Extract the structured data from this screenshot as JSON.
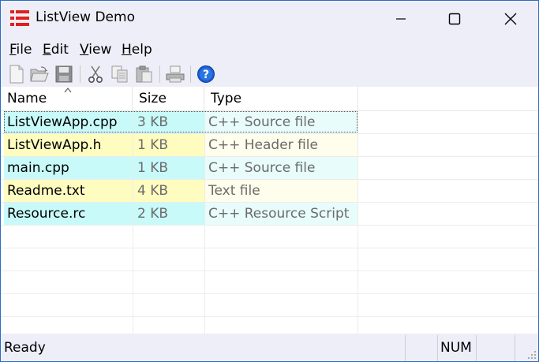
{
  "window": {
    "title": "ListView Demo",
    "accent": "#2a6ebf",
    "icon": "list-app-icon"
  },
  "menu": {
    "items": [
      {
        "label": "File",
        "u": "F",
        "rest": "ile"
      },
      {
        "label": "Edit",
        "u": "E",
        "rest": "dit"
      },
      {
        "label": "View",
        "u": "V",
        "rest": "iew"
      },
      {
        "label": "Help",
        "u": "H",
        "rest": "elp"
      }
    ]
  },
  "toolbar": {
    "buttons": [
      "new-icon",
      "open-icon",
      "save-icon",
      "cut-icon",
      "copy-icon",
      "paste-icon",
      "print-icon",
      "help-icon"
    ]
  },
  "list": {
    "columns": [
      "Name",
      "Size",
      "Type"
    ],
    "sort_column": "Name",
    "rows": [
      {
        "name": "ListViewApp.cpp",
        "size": "3 KB",
        "type": "C++ Source file",
        "color": "#c8fafa",
        "type_color": "#e8fcfc"
      },
      {
        "name": "ListViewApp.h",
        "size": "1 KB",
        "type": "C++ Header file",
        "color": "#fffcc0",
        "type_color": "#fffdeb"
      },
      {
        "name": "main.cpp",
        "size": "1 KB",
        "type": "C++ Source file",
        "color": "#c8fafa",
        "type_color": "#e8fcfc"
      },
      {
        "name": "Readme.txt",
        "size": "4 KB",
        "type": "Text file",
        "color": "#fffcc0",
        "type_color": "#fffdeb"
      },
      {
        "name": "Resource.rc",
        "size": "2 KB",
        "type": "C++ Resource Script",
        "color": "#c8fafa",
        "type_color": "#e8fcfc"
      }
    ]
  },
  "status": {
    "text": "Ready",
    "num": "NUM"
  }
}
